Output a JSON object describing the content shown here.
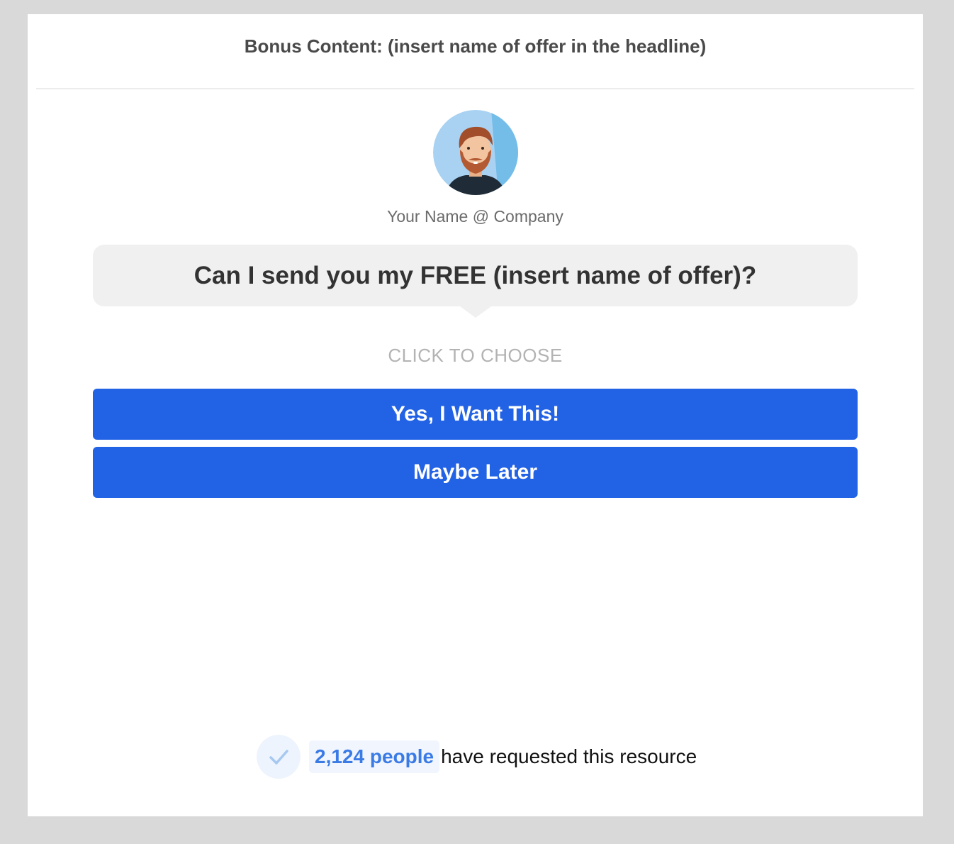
{
  "header": {
    "title": "Bonus Content: (insert name of offer in the headline)"
  },
  "sender": {
    "avatar_icon": "avatar-icon",
    "name": "Your Name @ Company"
  },
  "bubble": {
    "question": "Can I send you my FREE (insert name of offer)?"
  },
  "choose_hint": "CLICK TO CHOOSE",
  "buttons": {
    "yes_label": "Yes, I Want This!",
    "later_label": "Maybe Later",
    "color": "#2262e4"
  },
  "social_proof": {
    "check_icon": "check-icon",
    "count": "2,124 people",
    "text": "have requested this resource"
  }
}
